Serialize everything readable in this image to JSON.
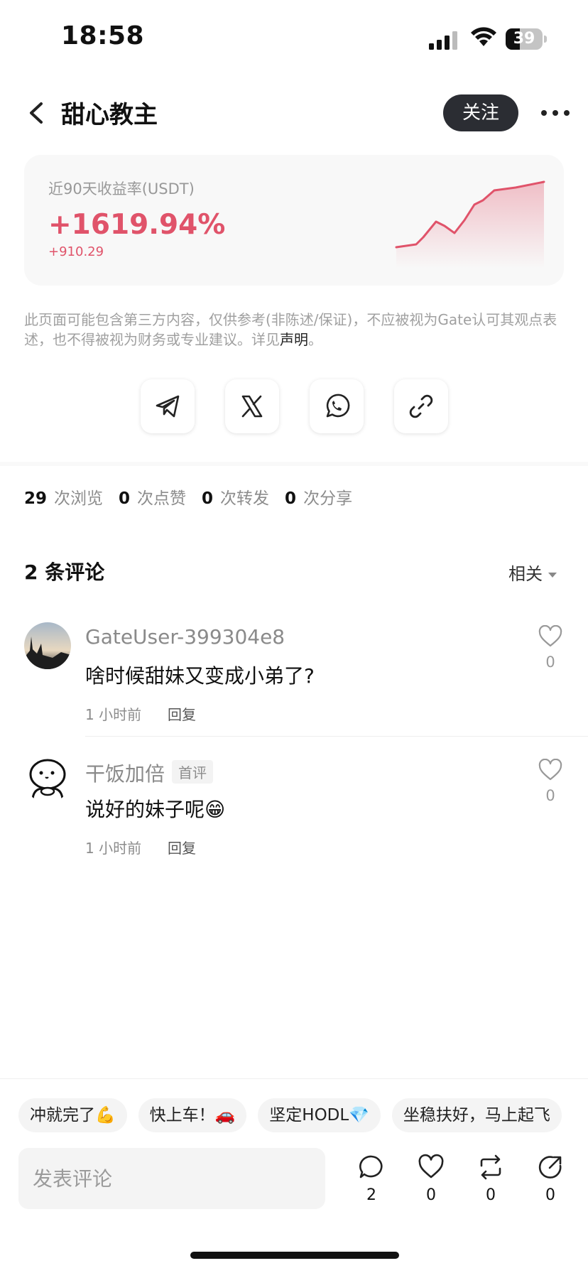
{
  "status_bar": {
    "time": "18:58",
    "battery": "39",
    "battery_percent": 39
  },
  "header": {
    "back_icon": "chevron-left-icon",
    "title": "甜心教主",
    "follow_label": "关注",
    "more_icon": "more-horizontal-icon"
  },
  "earnings": {
    "label": "近90天收益率(USDT)",
    "percent": "+1619.94%",
    "amount": "+910.29",
    "color": "#e0536a"
  },
  "disclaimer": {
    "text": "此页面可能包含第三方内容，仅供参考(非陈述/保证)，不应被视为Gate认可其观点表述，也不得被视为财务或专业建议。详见",
    "link": "声明",
    "end": "。"
  },
  "share": [
    {
      "icon": "telegram-icon"
    },
    {
      "icon": "x-logo-icon"
    },
    {
      "icon": "whatsapp-icon"
    },
    {
      "icon": "link-icon"
    }
  ],
  "stats": {
    "views": "29",
    "views_label": "次浏览",
    "likes": "0",
    "likes_label": "次点赞",
    "reposts": "0",
    "reposts_label": "次转发",
    "shares": "0",
    "shares_label": "次分享"
  },
  "comments_section": {
    "title": "2 条评论",
    "sort_label": "相关"
  },
  "comments": [
    {
      "user": "GateUser-399304e8",
      "text": "啥时候甜妹又变成小弟了?",
      "time": "1 小时前",
      "reply": "回复",
      "likes": "0"
    },
    {
      "user": "干饭加倍",
      "badge": "首评",
      "text": "说好的妹子呢😁",
      "time": "1 小时前",
      "reply": "回复",
      "likes": "0"
    }
  ],
  "quick_replies": [
    "冲就完了💪",
    "快上车！🚗",
    "坚定HODL💎",
    "坐稳扶好，马上起飞"
  ],
  "bottom_bar": {
    "input_placeholder": "发表评论",
    "comment_count": "2",
    "like_count": "0",
    "repost_count": "0",
    "share_count": "0"
  }
}
